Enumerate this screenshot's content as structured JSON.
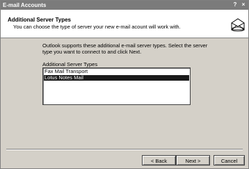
{
  "window": {
    "title": "E-mail Accounts",
    "help_label": "?",
    "close_label": "×"
  },
  "header": {
    "title": "Additional Server Types",
    "subtitle": "You can choose the type of server your new e-mail acount will work with.",
    "logo_icon": "email-accounts-icon"
  },
  "content": {
    "description": "Outlook supports these additional e-mail server types. Select the server type you want to connect to and click Next.",
    "list_label": "Additional Server Types",
    "list_items": [
      "Fax Mail Transport",
      "Lotus Notes Mail"
    ],
    "selected_index": 1
  },
  "buttons": {
    "back": "< Back",
    "next": "Next >",
    "cancel": "Cancel"
  }
}
